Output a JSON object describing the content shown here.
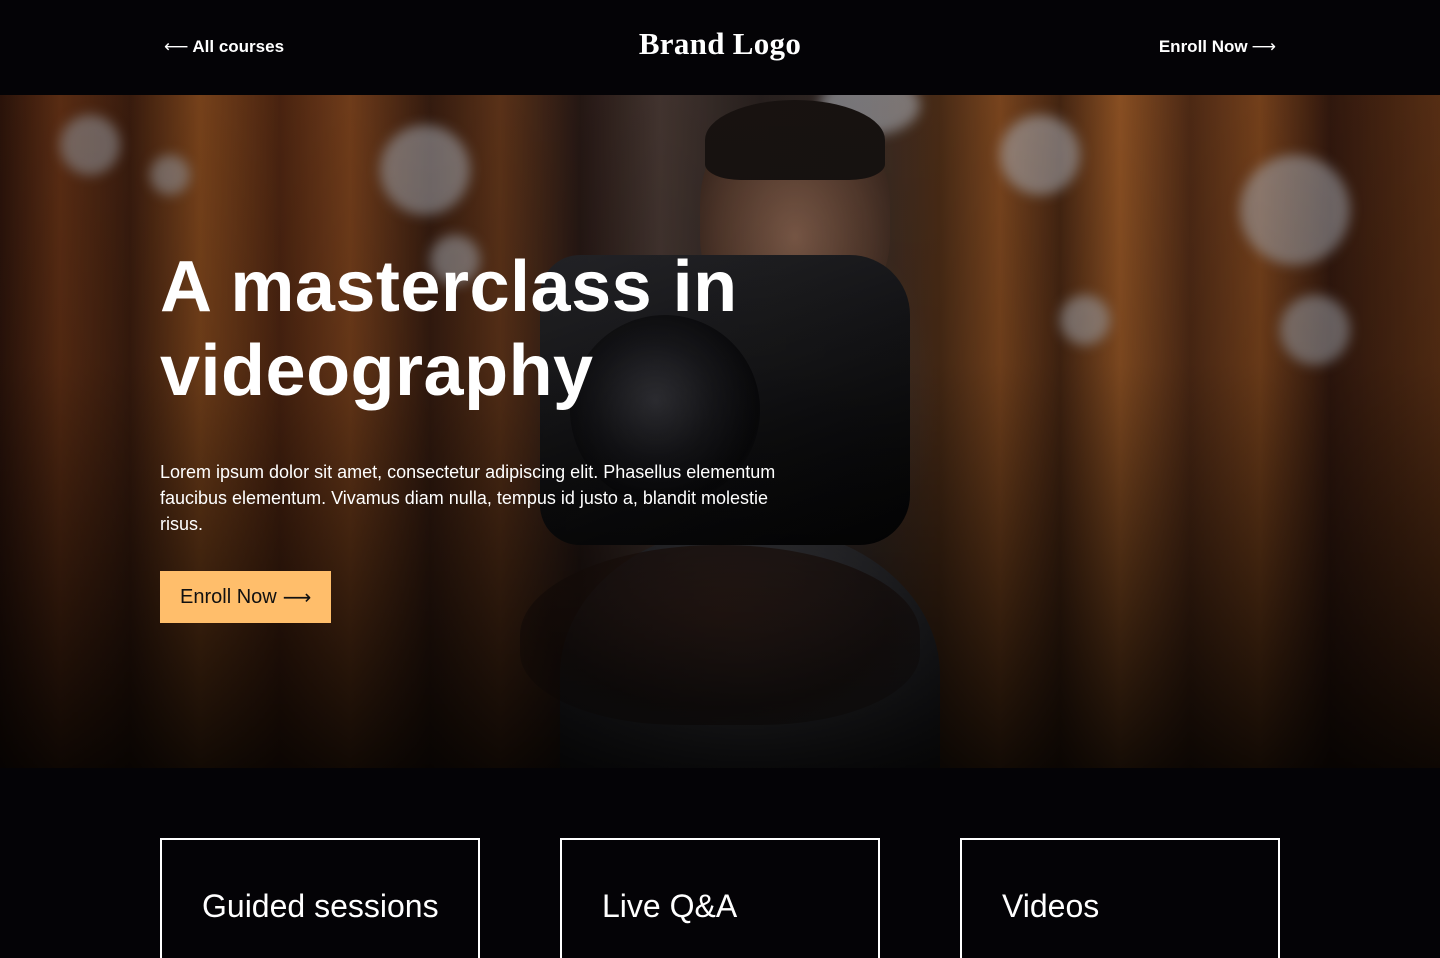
{
  "header": {
    "back_link": {
      "arrow": "⟵",
      "label": "All courses"
    },
    "brand": "Brand Logo",
    "enroll_link": {
      "label": "Enroll Now",
      "arrow": "⟶"
    }
  },
  "hero": {
    "title": "A masterclass in videography",
    "description": "Lorem ipsum dolor sit amet, consectetur adipiscing elit. Phasellus elementum faucibus elementum. Vivamus diam nulla, tempus id justo a, blandit molestie risus.",
    "cta": {
      "label": "Enroll Now",
      "arrow": "⟶"
    },
    "background_image": "photographer-with-camera-in-forest"
  },
  "features": [
    {
      "title": "Guided sessions"
    },
    {
      "title": "Live Q&A"
    },
    {
      "title": "Videos"
    }
  ],
  "colors": {
    "background": "#040306",
    "accent": "#ffbe6b",
    "text": "#ffffff"
  }
}
